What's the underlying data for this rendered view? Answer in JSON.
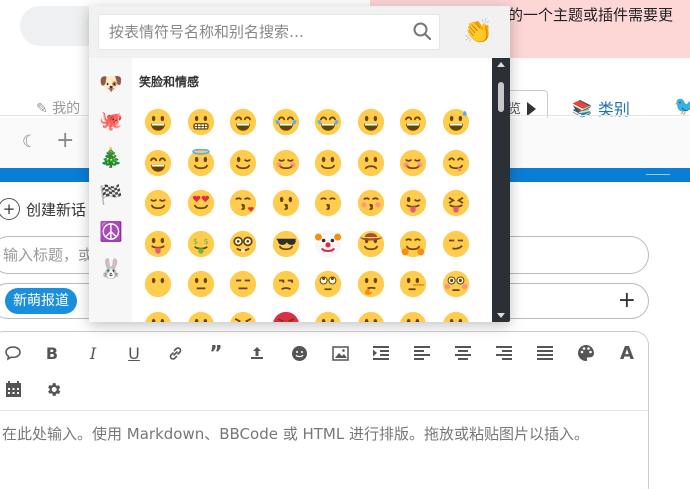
{
  "background": {
    "notice_text": "的一个主题或插件需要更",
    "my_link_label": "我的",
    "nav_button_label": "览",
    "category_tab_label": "类别"
  },
  "composer": {
    "create_label": "创建新话",
    "title_placeholder": "输入标题，或",
    "tag_label": "新萌报道",
    "editor_placeholder": "在此处输入。使用 Markdown、BBCode 或 HTML 进行排版。拖放或粘贴图片以插入。",
    "toolbar_icons": [
      "quote-bubble-icon",
      "bold-icon",
      "italic-icon",
      "underline-icon",
      "link-icon",
      "blockquote-icon",
      "upload-icon",
      "emoji-icon",
      "image-icon",
      "indent-icon",
      "align-left-icon",
      "align-center-icon",
      "align-right-icon",
      "align-justify-icon",
      "palette-icon",
      "font-icon"
    ],
    "toolbar2_icons": [
      "calendar-icon",
      "gear-icon"
    ]
  },
  "emoji_picker": {
    "search_placeholder": "按表情符号名称和别名搜索…",
    "selected_tone": "👏",
    "section_title": "笑脸和情感",
    "categories": [
      {
        "name": "favorites",
        "emoji": "🐶"
      },
      {
        "name": "smileys",
        "emoji": "🐙"
      },
      {
        "name": "objects",
        "emoji": "🎄"
      },
      {
        "name": "flags",
        "emoji": "🏁"
      },
      {
        "name": "symbols",
        "emoji": "☮️"
      },
      {
        "name": "custom",
        "emoji": "🐰"
      }
    ],
    "emojis": [
      "😀",
      "😬",
      "😁",
      "😂",
      "🤣",
      "😃",
      "😄",
      "😅",
      "😆",
      "😇",
      "😉",
      "😊",
      "🙂",
      "🙃",
      "☺️",
      "😋",
      "😌",
      "😍",
      "😘",
      "😗",
      "😙",
      "😚",
      "😜",
      "😝",
      "😛",
      "🤑",
      "🤓",
      "😎",
      "🤡",
      "🤠",
      "🤗",
      "😏",
      "😶",
      "😐",
      "😑",
      "😒",
      "🙄",
      "🤔",
      "🤥",
      "😳",
      "😞",
      "😟",
      "😠",
      "😡",
      "😔",
      "😕",
      "🙁",
      "☹️"
    ]
  },
  "colors": {
    "accent_blue": "#0a7dd6",
    "tag_blue": "#1a8fde",
    "notice_pink": "#fdd6d6",
    "scrollbar_dark": "#2b2f36"
  }
}
